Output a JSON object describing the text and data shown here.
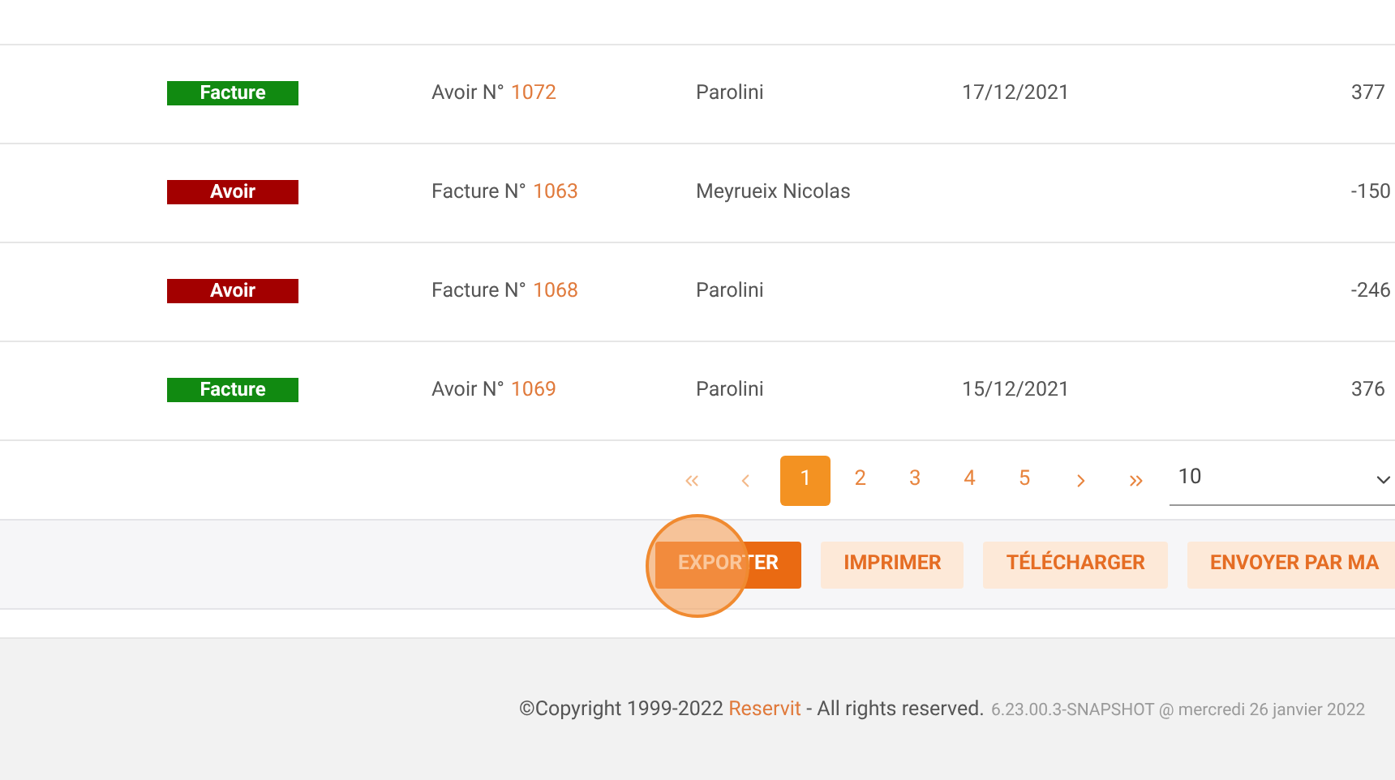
{
  "table": {
    "rows": [
      {
        "badge": {
          "label": "Facture",
          "kind": "facture"
        },
        "document": "Avoir N°",
        "number": "1072",
        "client": "Parolini",
        "date": "17/12/2021",
        "amount": "377"
      },
      {
        "badge": {
          "label": "Avoir",
          "kind": "avoir"
        },
        "document": "Facture N°",
        "number": "1063",
        "client": "Meyrueix Nicolas",
        "date": "",
        "amount": "-150"
      },
      {
        "badge": {
          "label": "Avoir",
          "kind": "avoir"
        },
        "document": "Facture N°",
        "number": "1068",
        "client": "Parolini",
        "date": "",
        "amount": "-246"
      },
      {
        "badge": {
          "label": "Facture",
          "kind": "facture"
        },
        "document": "Avoir N°",
        "number": "1069",
        "client": "Parolini",
        "date": "15/12/2021",
        "amount": "376"
      }
    ]
  },
  "pagination": {
    "pages": [
      {
        "label": "1",
        "selected": true
      },
      {
        "label": "2",
        "selected": false
      },
      {
        "label": "3",
        "selected": false
      },
      {
        "label": "4",
        "selected": false
      },
      {
        "label": "5",
        "selected": false
      }
    ],
    "page_size": "10"
  },
  "actions": [
    {
      "label": "EXPORTER",
      "kind": "primary"
    },
    {
      "label": "IMPRIMER",
      "kind": "secondary"
    },
    {
      "label": "TÉLÉCHARGER",
      "kind": "secondary"
    },
    {
      "label": "ENVOYER PAR MA",
      "kind": "secondary"
    }
  ],
  "footer": {
    "copyright_before": "©Copyright 1999-2022 ",
    "link": "Reservit",
    "copyright_after": " - All rights reserved.",
    "version": "6.23.00.3-SNAPSHOT @ mercredi 26 janvier 2022"
  }
}
